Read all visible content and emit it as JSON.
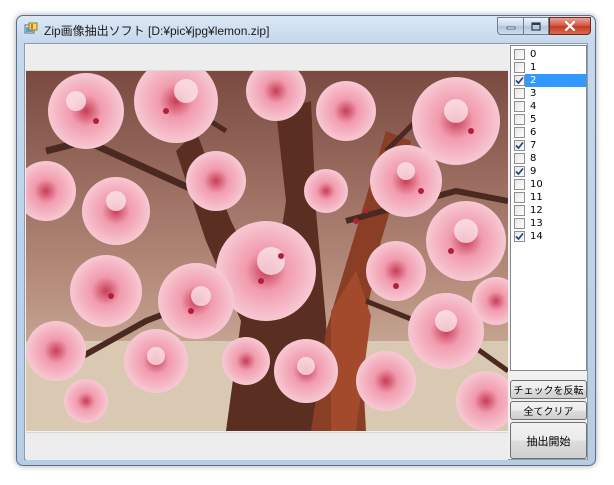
{
  "window": {
    "title": "Zip画像抽出ソフト [D:¥pic¥jpg¥lemon.zip]"
  },
  "file_list": [
    {
      "label": "0",
      "checked": false,
      "selected": false
    },
    {
      "label": "1",
      "checked": false,
      "selected": false
    },
    {
      "label": "2",
      "checked": true,
      "selected": true
    },
    {
      "label": "3",
      "checked": false,
      "selected": false
    },
    {
      "label": "4",
      "checked": false,
      "selected": false
    },
    {
      "label": "5",
      "checked": false,
      "selected": false
    },
    {
      "label": "6",
      "checked": false,
      "selected": false
    },
    {
      "label": "7",
      "checked": true,
      "selected": false
    },
    {
      "label": "8",
      "checked": false,
      "selected": false
    },
    {
      "label": "9",
      "checked": true,
      "selected": false
    },
    {
      "label": "10",
      "checked": false,
      "selected": false
    },
    {
      "label": "11",
      "checked": false,
      "selected": false
    },
    {
      "label": "12",
      "checked": false,
      "selected": false
    },
    {
      "label": "13",
      "checked": false,
      "selected": false
    },
    {
      "label": "14",
      "checked": true,
      "selected": false
    }
  ],
  "buttons": {
    "invert_label": "チェックを反転",
    "clear_label": "全てクリア",
    "extract_label": "抽出開始"
  },
  "colors": {
    "selection": "#3399ff",
    "close_button": "#c8432c",
    "blossom": "#f2a3b3"
  }
}
